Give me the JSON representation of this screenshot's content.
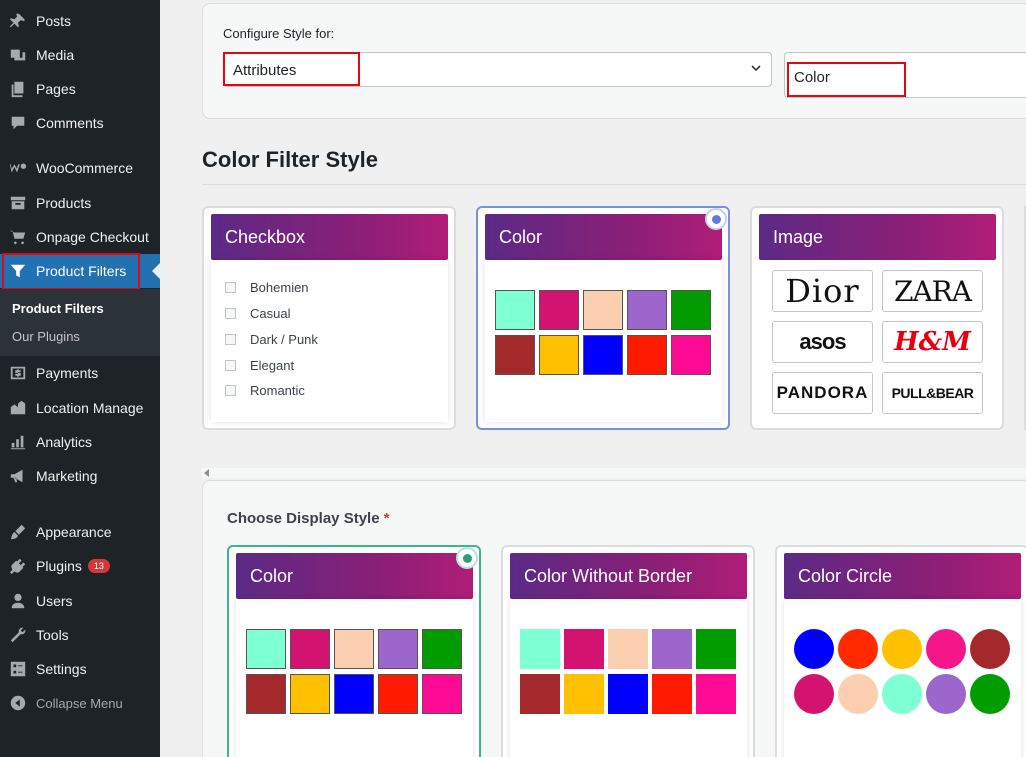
{
  "sidebar": {
    "items": [
      {
        "label": "Posts",
        "icon": "pin-icon"
      },
      {
        "label": "Media",
        "icon": "media-icon"
      },
      {
        "label": "Pages",
        "icon": "pages-icon"
      },
      {
        "label": "Comments",
        "icon": "comment-icon"
      },
      {
        "label": "WooCommerce",
        "icon": "woo-icon"
      },
      {
        "label": "Products",
        "icon": "archive-icon"
      },
      {
        "label": "Onpage Checkout",
        "icon": "cart-icon"
      },
      {
        "label": "Product Filters",
        "icon": "filter-icon"
      },
      {
        "label": "Payments",
        "icon": "dollar-icon"
      },
      {
        "label": "Location Manage",
        "icon": "location-icon"
      },
      {
        "label": "Analytics",
        "icon": "chart-icon"
      },
      {
        "label": "Marketing",
        "icon": "megaphone-icon"
      },
      {
        "label": "Appearance",
        "icon": "brush-icon"
      },
      {
        "label": "Plugins",
        "icon": "plugin-icon"
      },
      {
        "label": "Users",
        "icon": "user-icon"
      },
      {
        "label": "Tools",
        "icon": "wrench-icon"
      },
      {
        "label": "Settings",
        "icon": "settings-icon"
      }
    ],
    "submenu": [
      "Product Filters",
      "Our Plugins"
    ],
    "plugins_badge": "13",
    "collapse_label": "Collapse Menu"
  },
  "configure": {
    "label": "Configure Style for:",
    "type_value": "Attributes",
    "attribute_value": "Color"
  },
  "filter_style": {
    "heading": "Color Filter Style",
    "cards": [
      {
        "title": "Checkbox",
        "options": [
          "Bohemien",
          "Casual",
          "Dark / Punk",
          "Elegant",
          "Romantic"
        ]
      },
      {
        "title": "Color"
      },
      {
        "title": "Image",
        "brands": [
          "Dior",
          "ZARA",
          "asos",
          "H&M",
          "PANDORA",
          "PULL&BEAR"
        ]
      }
    ]
  },
  "display_style": {
    "label": "Choose Display Style",
    "required_mark": "*",
    "cards": [
      {
        "title": "Color"
      },
      {
        "title": "Color Without Border"
      },
      {
        "title": "Color Circle"
      }
    ]
  },
  "colors": {
    "swatches": [
      "#7fffd4",
      "#d3136f",
      "#fbcfb0",
      "#9c66cc",
      "#009c00",
      "#a3292a",
      "#ffc000",
      "#0000ff",
      "#ff1a00",
      "#ff0a94"
    ],
    "circles": [
      "#0000ff",
      "#ff2a00",
      "#ffc000",
      "#f5168a",
      "#a3292a",
      "#d3136f",
      "#fbcfb0",
      "#7fffd4",
      "#9c66cc",
      "#009c00"
    ],
    "accent": "#2271b1",
    "highlight_outline": "#e30613"
  }
}
